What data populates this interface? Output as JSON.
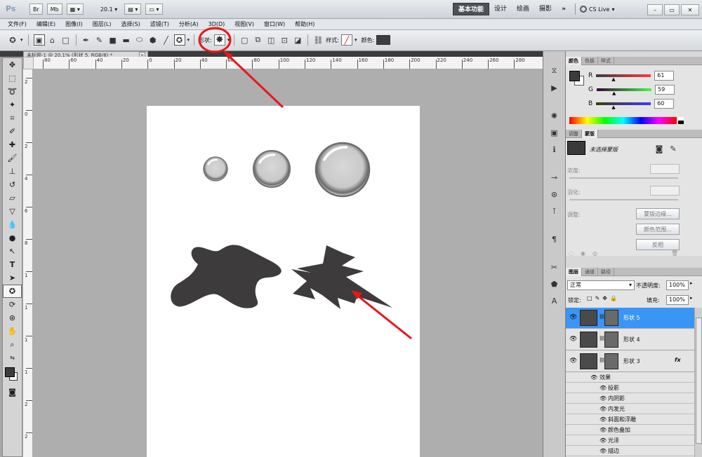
{
  "app": {
    "logo": "Ps",
    "top_buttons": [
      "Br",
      "Mb"
    ],
    "zoom_value": "20.1",
    "workspaces": [
      "基本功能",
      "设计",
      "绘画",
      "摄影"
    ],
    "more": "»",
    "cslive": "CS Live"
  },
  "menu": [
    "文件(F)",
    "编辑(E)",
    "图像(I)",
    "图层(L)",
    "选择(S)",
    "滤镜(T)",
    "分析(A)",
    "3D(D)",
    "视图(V)",
    "窗口(W)",
    "帮助(H)"
  ],
  "options": {
    "shape_label": "形状:",
    "style_label": "样式:",
    "color_label": "颜色:",
    "color": "#3d3d3d"
  },
  "document": {
    "tab_title": "未标题-1 @ 20.1% (形状 5, RGB/8) *",
    "close": "×"
  },
  "ruler_top": [
    "80",
    "60",
    "40",
    "20",
    "0",
    "20",
    "40",
    "60",
    "80",
    "100",
    "120",
    "140",
    "160",
    "180",
    "200",
    "220",
    "240",
    "260",
    "280"
  ],
  "ruler_left": [
    "2",
    "0",
    "2",
    "4",
    "6",
    "8",
    "1",
    "1",
    "1",
    "1",
    "2",
    "2"
  ],
  "color_panel": {
    "tabs": [
      "颜色",
      "色板",
      "样式"
    ],
    "r_label": "R",
    "r_value": "61",
    "g_label": "G",
    "g_value": "59",
    "b_label": "B",
    "b_value": "60",
    "foreground": "#3d3b3c"
  },
  "mask_panel": {
    "tabs": [
      "调整",
      "蒙版"
    ],
    "title": "未选择蒙版",
    "density_label": "浓度:",
    "feather_label": "羽化:",
    "adjust_label": "调整:",
    "buttons": [
      "蒙版边缘...",
      "颜色范围...",
      "反相"
    ]
  },
  "layers_panel": {
    "tabs": [
      "图层",
      "通道",
      "路径"
    ],
    "blend_mode": "正常",
    "opacity_label": "不透明度:",
    "opacity_value": "100%",
    "lock_label": "锁定:",
    "fill_label": "填充:",
    "fill_value": "100%",
    "layers": [
      "形状 5",
      "形状 4",
      "形状 3"
    ],
    "fx": "fx",
    "effects_label": "效果",
    "effects": [
      "投影",
      "内阴影",
      "内发光",
      "斜面和浮雕",
      "颜色叠加",
      "光泽",
      "描边"
    ]
  },
  "colors": {
    "accent": "#3a95f5",
    "annotation": "#e8161b",
    "shape_fill": "#3d3b3c"
  }
}
